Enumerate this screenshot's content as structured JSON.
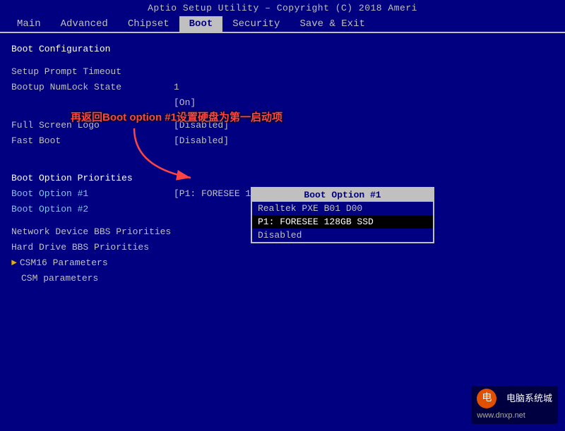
{
  "title_bar": {
    "text": "Aptio Setup Utility – Copyright (C) 2018 Ameri"
  },
  "menu": {
    "items": [
      {
        "label": "Main",
        "active": false
      },
      {
        "label": "Advanced",
        "active": false
      },
      {
        "label": "Chipset",
        "active": false
      },
      {
        "label": "Boot",
        "active": true
      },
      {
        "label": "Security",
        "active": false
      },
      {
        "label": "Save & Exit",
        "active": false
      }
    ]
  },
  "boot_config": {
    "section_label": "Boot Configuration",
    "rows": [
      {
        "label": "Setup Prompt Timeout",
        "value": ""
      },
      {
        "label": "Bootup NumLock State",
        "value": "1"
      }
    ],
    "numlock_state": "[On]",
    "full_screen_logo_label": "Full Screen Logo",
    "fast_boot_label": "Fast Boot",
    "full_screen_logo_value": "[Disabled]",
    "fast_boot_value": "[Disabled]"
  },
  "boot_options": {
    "section_label": "Boot Option Priorities",
    "option1_label": "Boot Option #1",
    "option2_label": "Boot Option #2",
    "option1_value": "[P1: FORESEE 128GB S...]",
    "option2_value": ""
  },
  "network": {
    "label": "Network Device BBS Priorities"
  },
  "hard_drive": {
    "label": "Hard Drive BBS Priorities"
  },
  "csm16": {
    "label": "CSM16 Parameters",
    "arrow": true
  },
  "csm": {
    "label": "CSM parameters"
  },
  "dropdown": {
    "title": "Boot Option #1",
    "items": [
      {
        "label": "Realtek PXE B01 D00",
        "selected": false
      },
      {
        "label": "P1: FORESEE 128GB SSD",
        "selected": true
      },
      {
        "label": "Disabled",
        "selected": false
      }
    ]
  },
  "annotation": {
    "text": "再返回Boot option #1设置硬盘为第一启动项"
  },
  "watermark": {
    "icon": "电",
    "text": "电脑系统城",
    "url_text": "www.dnxp.net"
  }
}
